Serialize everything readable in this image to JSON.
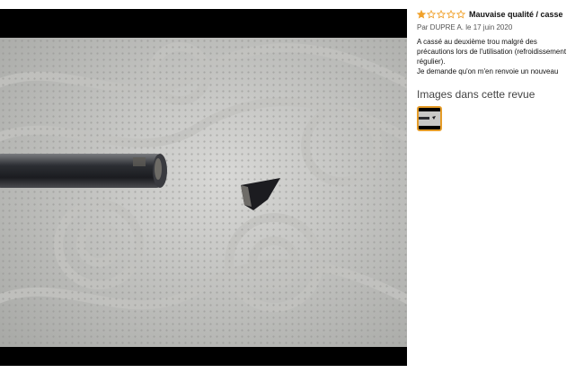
{
  "review": {
    "rating_value": 1,
    "rating_max": 5,
    "star_color": "#f0a12b",
    "title": "Mauvaise qualité / casse",
    "byline": "Par DUPRE A. le 17 juin 2020",
    "body_lines": [
      "A cassé au deuxième trou malgré des",
      "précautions lors de l'utilisation (refroidissement",
      "régulier).",
      "Je demande qu'on m'en renvoie un nouveau"
    ]
  },
  "images_section": {
    "heading": "Images dans cette revue",
    "thumbnails": [
      {
        "selected": true,
        "border_color": "#e59c28"
      }
    ]
  },
  "viewer": {
    "background": "#000000",
    "photo_subject": "broken-drill-bit-on-paper-towel"
  }
}
